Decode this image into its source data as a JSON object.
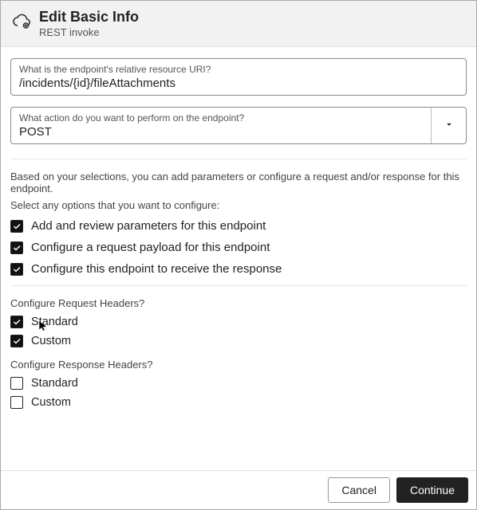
{
  "header": {
    "title": "Edit Basic Info",
    "subtitle": "REST invoke"
  },
  "fields": {
    "uri": {
      "label": "What is the endpoint's relative resource URI?",
      "value": "/incidents/{id}/fileAttachments"
    },
    "action": {
      "label": "What action do you want to perform on the endpoint?",
      "value": "POST"
    }
  },
  "info": {
    "line1": "Based on your selections, you can add parameters or configure a request and/or response for this endpoint.",
    "line2": "Select any options that you want to configure:"
  },
  "options": {
    "addParams": {
      "label": "Add and review parameters for this endpoint",
      "checked": true
    },
    "reqPayload": {
      "label": "Configure a request payload for this endpoint",
      "checked": true
    },
    "recvResponse": {
      "label": "Configure this endpoint to receive the response",
      "checked": true
    }
  },
  "reqHeaders": {
    "label": "Configure Request Headers?",
    "standard": {
      "label": "Standard",
      "checked": true
    },
    "custom": {
      "label": "Custom",
      "checked": true
    }
  },
  "respHeaders": {
    "label": "Configure Response Headers?",
    "standard": {
      "label": "Standard",
      "checked": false
    },
    "custom": {
      "label": "Custom",
      "checked": false
    }
  },
  "footer": {
    "cancel": "Cancel",
    "continue": "Continue"
  }
}
